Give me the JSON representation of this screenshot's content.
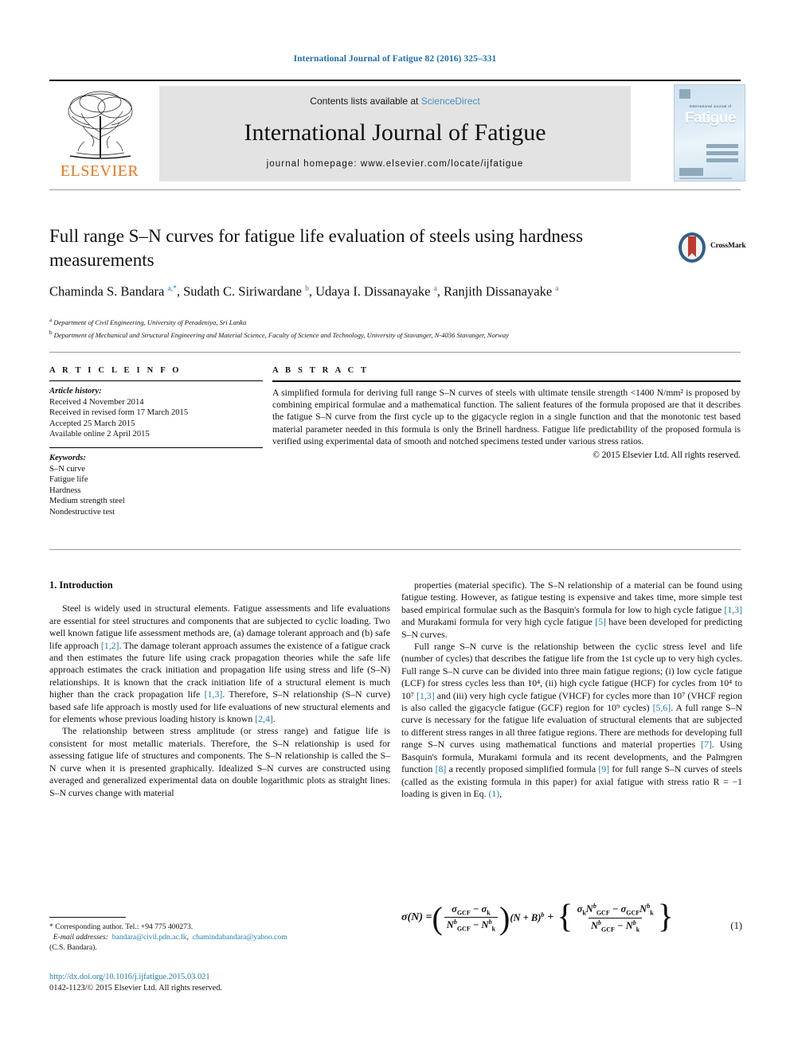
{
  "running_head": "International Journal of Fatigue 82 (2016) 325–331",
  "masthead": {
    "contents_prefix": "Contents lists available at ",
    "sciencedirect": "ScienceDirect",
    "journal_title": "International Journal of Fatigue",
    "homepage": "journal homepage: www.elsevier.com/locate/ijfatigue",
    "publisher": "ELSEVIER",
    "cover": {
      "sub": "International Journal of",
      "title": "Fatigue"
    }
  },
  "article": {
    "title": "Full range S–N curves for fatigue life evaluation of steels using hardness measurements",
    "crossmark_label": "CrossMark",
    "authors_html": "Chaminda S. Bandara <sup>a,*</sup>, Sudath C. Siriwardane <sup>b</sup>, Udaya I. Dissanayake <sup>a</sup>, Ranjith Dissanayake <sup>a</sup>",
    "affiliations": [
      "Department of Civil Engineering, University of Peradeniya, Sri Lanka",
      "Department of Mechanical and Structural Engineering and Material Science, Faculty of Science and Technology, University of Stavanger, N-4036 Stavanger, Norway"
    ]
  },
  "info": {
    "heading": "A R T I C L E    I N F O",
    "history_label": "Article history:",
    "history": [
      "Received 4 November 2014",
      "Received in revised form 17 March 2015",
      "Accepted 25 March 2015",
      "Available online 2 April 2015"
    ],
    "keywords_label": "Keywords:",
    "keywords": [
      "S–N curve",
      "Fatigue life",
      "Hardness",
      "Medium strength steel",
      "Nondestructive test"
    ]
  },
  "abstract": {
    "heading": "A B S T R A C T",
    "text": "A simplified formula for deriving full range S–N curves of steels with ultimate tensile strength <1400 N/mm² is proposed by combining empirical formulae and a mathematical function. The salient features of the formula proposed are that it describes the fatigue S–N curve from the first cycle up to the gigacycle region in a single function and that the monotonic test based material parameter needed in this formula is only the Brinell hardness. Fatigue life predictability of the proposed formula is verified using experimental data of smooth and notched specimens tested under various stress ratios.",
    "copyright": "© 2015 Elsevier Ltd. All rights reserved."
  },
  "body": {
    "section_heading": "1. Introduction",
    "left_paragraphs": [
      "Steel is widely used in structural elements. Fatigue assessments and life evaluations are essential for steel structures and components that are subjected to cyclic loading. Two well known fatigue life assessment methods are, (a) damage tolerant approach and (b) safe life approach [1,2]. The damage tolerant approach assumes the existence of a fatigue crack and then estimates the future life using crack propagation theories while the safe life approach estimates the crack initiation and propagation life using stress and life (S–N) relationships. It is known that the crack initiation life of a structural element is much higher than the crack propagation life [1,3]. Therefore, S–N relationship (S–N curve) based safe life approach is mostly used for life evaluations of new structural elements and for elements whose previous loading history is known [2,4].",
      "The relationship between stress amplitude (or stress range) and fatigue life is consistent for most metallic materials. Therefore, the S–N relationship is used for assessing fatigue life of structures and components. The S–N relationship is called the S–N curve when it is presented graphically. Idealized S–N curves are constructed using averaged and generalized experimental data on double logarithmic plots as straight lines. S–N curves change with material"
    ],
    "right_paragraphs": [
      "properties (material specific). The S–N relationship of a material can be found using fatigue testing. However, as fatigue testing is expensive and takes time, more simple test based empirical formulae such as the Basquin's formula for low to high cycle fatigue [1,3] and Murakami formula for very high cycle fatigue [5] have been developed for predicting S–N curves.",
      "Full range S–N curve is the relationship between the cyclic stress level and life (number of cycles) that describes the fatigue life from the 1st cycle up to very high cycles. Full range S–N curve can be divided into three main fatigue regions; (i) low cycle fatigue (LCF) for stress cycles less than 10⁴, (ii) high cycle fatigue (HCF) for cycles from 10⁴ to 10⁷ [1,3] and (iii) very high cycle fatigue (VHCF) for cycles more than 10⁷ (VHCF region is also called the gigacycle fatigue (GCF) region for 10⁹ cycles) [5,6]. A full range S–N curve is necessary for the fatigue life evaluation of structural elements that are subjected to different stress ranges in all three fatigue regions. There are methods for developing full range S–N curves using mathematical functions and material properties [7]. Using Basquin's formula, Murakami formula and its recent developments, and the Palmgren function [8] a recently proposed simplified formula [9] for full range S–N curves of steels (called as the existing formula in this paper) for axial fatigue with stress ratio R = −1 loading is given in Eq. (1),"
    ]
  },
  "equation": {
    "lhs": "σ(N) =",
    "frac1_num": "σGCF − σk",
    "frac1_den": "NbGCF − Nbk",
    "mid": "(N + B)b",
    "plus": "+",
    "frac2_num": "σkNbGCF − σGCFNbk",
    "frac2_den": "NbGCF − Nbk",
    "number": "(1)"
  },
  "footnotes": {
    "corresponding": "* Corresponding author. Tel.: +94 775 400273.",
    "email_label": "E-mail addresses:",
    "email1": "bandara@civil.pdn.ac.lk",
    "email2": "chamindabandara@yahoo.com",
    "email_owner": "(C.S. Bandara).",
    "doi": "http://dx.doi.org/10.1016/j.ijfatigue.2015.03.021",
    "issn": "0142-1123/© 2015 Elsevier Ltd. All rights reserved."
  }
}
